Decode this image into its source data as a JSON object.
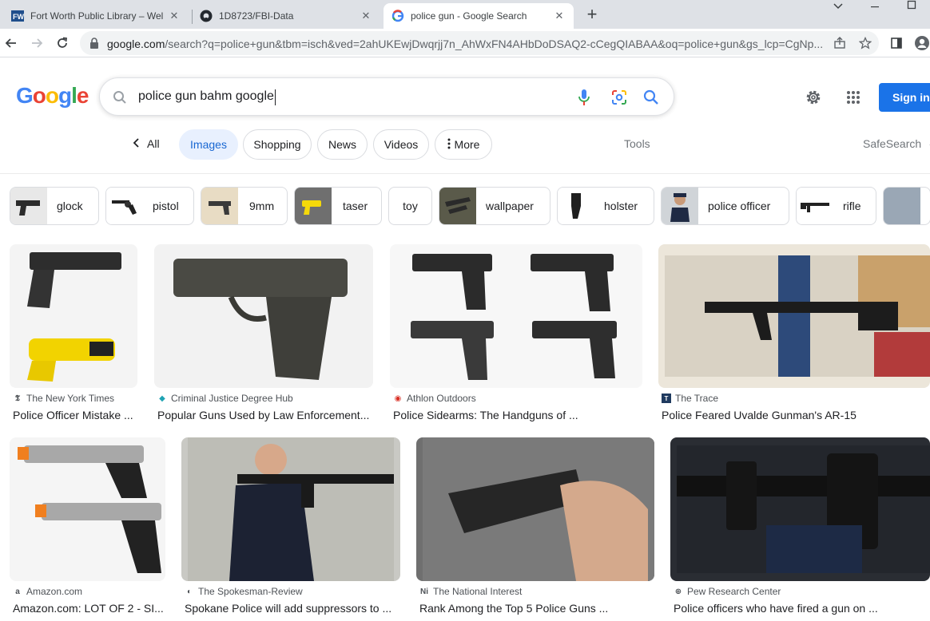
{
  "browser": {
    "tabs": [
      {
        "title": "Fort Worth Public Library – Welco",
        "icon": "library-favicon"
      },
      {
        "title": "1D8723/FBI-Data",
        "icon": "github-icon"
      },
      {
        "title": "police gun - Google Search",
        "icon": "google-icon"
      }
    ],
    "url_domain": "google.com",
    "url_rest": "/search?q=police+gun&tbm=isch&ved=2ahUKEwjDwqrjj7n_AhWxFN4AHbDoDSAQ2-cCegQIABAA&oq=police+gun&gs_lcp=CgNp..."
  },
  "search": {
    "query": "police gun bahm google",
    "logo": "Google"
  },
  "header": {
    "sign_in": "Sign in"
  },
  "nav": {
    "back_all": "All",
    "tabs": [
      "Images",
      "Shopping",
      "News",
      "Videos",
      "More"
    ],
    "tools": "Tools",
    "safesearch": "SafeSearch"
  },
  "chips": [
    "glock",
    "pistol",
    "9mm",
    "taser",
    "toy",
    "wallpaper",
    "holster",
    "police officer",
    "rifle"
  ],
  "results": [
    {
      "source": "The New York Times",
      "title": "Police Officer Mistake ..."
    },
    {
      "source": "Criminal Justice Degree Hub",
      "title": "Popular Guns Used by Law Enforcement..."
    },
    {
      "source": "Athlon Outdoors",
      "title": "Police Sidearms: The Handguns of ..."
    },
    {
      "source": "The Trace",
      "title": "Police Feared Uvalde Gunman's AR-15"
    },
    {
      "source": "Amazon.com",
      "title": "Amazon.com: LOT OF 2 - SI..."
    },
    {
      "source": "The Spokesman-Review",
      "title": "Spokane Police will add suppressors to ..."
    },
    {
      "source": "The National Interest",
      "title": "Rank Among the Top 5 Police Guns ..."
    },
    {
      "source": "Pew Research Center",
      "title": "Police officers who have fired a gun on ..."
    }
  ],
  "colors": {
    "accent": "#1a73e8",
    "active_pill_bg": "#e8f0fe",
    "active_pill_text": "#1967d2"
  }
}
